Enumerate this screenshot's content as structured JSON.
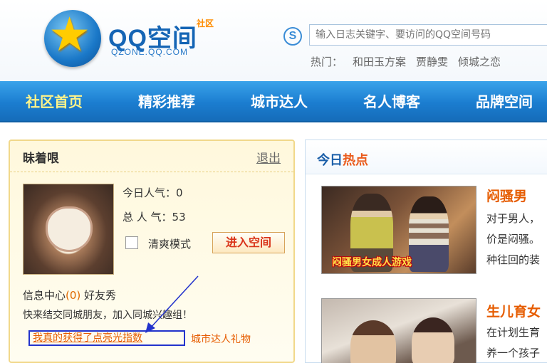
{
  "header": {
    "logo_text": "QQ空间",
    "logo_badge": "社区",
    "logo_sub": "QZONE.QQ.COM",
    "search_icon_letter": "S",
    "search_placeholder": "输入日志关键字、要访问的QQ空间号码",
    "hot_label": "热门：",
    "hot_items": [
      "和田玉方案",
      "贾静雯",
      "倾城之恋"
    ]
  },
  "nav": {
    "items": [
      "社区首页",
      "精彩推荐",
      "城市达人",
      "名人博客",
      "品牌空间"
    ],
    "active": "社区首页"
  },
  "left_panel": {
    "name": "昧着哏",
    "logout": "退出",
    "today_popularity": "今日人气：0",
    "total_popularity": "总 人 气：53",
    "simple_mode": "清爽模式",
    "enter_space": "进入空间",
    "message_center": "信息中心",
    "message_count": "(0)",
    "friend_show": "好友秀",
    "invite_text": "快来结交同城朋友，加入同城兴趣组！",
    "link_highlight": "我真的获得了点亮光指数",
    "link_gift": "城市达人礼物"
  },
  "right_panel": {
    "title_part1": "今日",
    "title_part2": "热点",
    "news": [
      {
        "title": "闷骚男",
        "image_caption": "闷骚男女成人游戏",
        "lines": [
          "对于男人，",
          "价是闷骚。",
          "种往回的装"
        ]
      },
      {
        "title": "生儿育女",
        "image_caption": "",
        "lines": [
          "在计划生育",
          "养一个孩子"
        ]
      }
    ]
  },
  "colors": {
    "nav_blue": "#1b7dd0",
    "nav_active": "#fff48a",
    "accent_orange": "#e65c00",
    "panel_yellow": "#fff8dc",
    "annotation_blue": "#2333cc"
  }
}
